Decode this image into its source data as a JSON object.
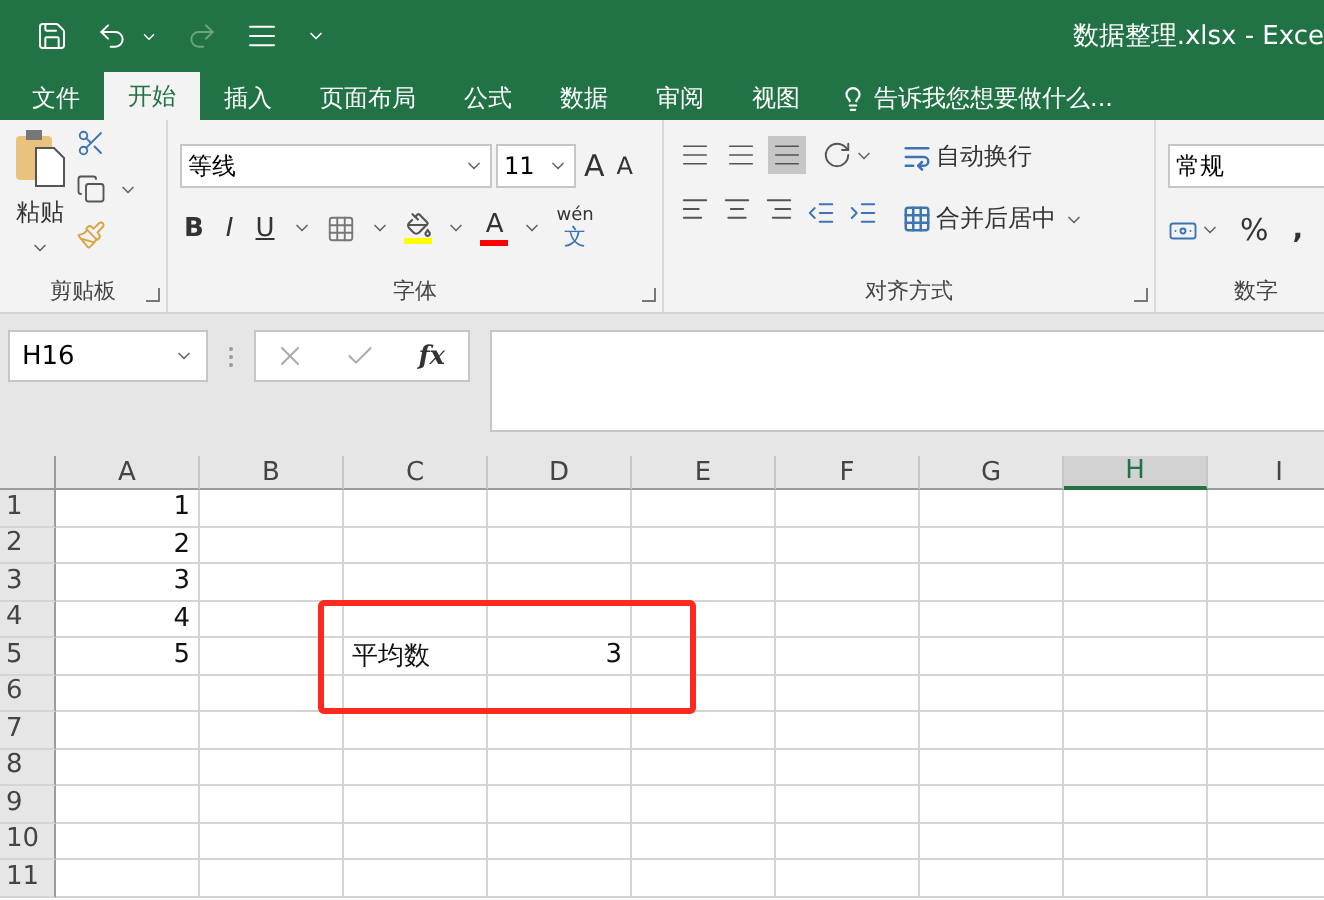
{
  "title_bar": {
    "title": "数据整理.xlsx - Exce"
  },
  "ribbon_tabs": [
    {
      "label": "文件",
      "selected": false
    },
    {
      "label": "开始",
      "selected": true
    },
    {
      "label": "插入",
      "selected": false
    },
    {
      "label": "页面布局",
      "selected": false
    },
    {
      "label": "公式",
      "selected": false
    },
    {
      "label": "数据",
      "selected": false
    },
    {
      "label": "审阅",
      "selected": false
    },
    {
      "label": "视图",
      "selected": false
    }
  ],
  "tell_me": "告诉我您想要做什么...",
  "clipboard": {
    "paste": "粘贴",
    "label": "剪贴板"
  },
  "font": {
    "font_name": "等线",
    "font_size": "11",
    "grow": "A",
    "shrink": "A",
    "bold": "B",
    "italic": "I",
    "underline": "U",
    "fill_letter": "A",
    "phonetic": "wén",
    "phonetic_char": "文",
    "label": "字体"
  },
  "alignment": {
    "vertical": [
      {
        "selected": false
      },
      {
        "selected": false
      },
      {
        "selected": true
      }
    ],
    "wrap_text": "自动换行",
    "merge_center": "合并后居中",
    "label": "对齐方式"
  },
  "number": {
    "format": "常规",
    "percent": "%",
    "comma": ",",
    "label": "数字"
  },
  "formula_bar": {
    "name_box": "H16",
    "fx": "fx"
  },
  "columns": [
    {
      "label": "A",
      "selected": false
    },
    {
      "label": "B",
      "selected": false
    },
    {
      "label": "C",
      "selected": false
    },
    {
      "label": "D",
      "selected": false
    },
    {
      "label": "E",
      "selected": false
    },
    {
      "label": "F",
      "selected": false
    },
    {
      "label": "G",
      "selected": false
    },
    {
      "label": "H",
      "selected": true
    },
    {
      "label": "I",
      "selected": false
    }
  ],
  "rows": [
    {
      "label": "1",
      "cells": [
        {
          "text": "1",
          "kind": "number"
        },
        null,
        null,
        null,
        null,
        null,
        null,
        null,
        null
      ]
    },
    {
      "label": "2",
      "cells": [
        {
          "text": "2",
          "kind": "number"
        },
        null,
        null,
        null,
        null,
        null,
        null,
        null,
        null
      ]
    },
    {
      "label": "3",
      "cells": [
        {
          "text": "3",
          "kind": "number"
        },
        null,
        null,
        null,
        null,
        null,
        null,
        null,
        null
      ]
    },
    {
      "label": "4",
      "cells": [
        {
          "text": "4",
          "kind": "number"
        },
        null,
        null,
        null,
        null,
        null,
        null,
        null,
        null
      ]
    },
    {
      "label": "5",
      "cells": [
        {
          "text": "5",
          "kind": "number"
        },
        null,
        {
          "text": "平均数",
          "kind": "text"
        },
        {
          "text": "3",
          "kind": "number"
        },
        null,
        null,
        null,
        null,
        null
      ]
    },
    {
      "label": "6"
    },
    {
      "label": "7"
    },
    {
      "label": "8"
    },
    {
      "label": "9"
    },
    {
      "label": "10"
    },
    {
      "label": "11"
    }
  ]
}
